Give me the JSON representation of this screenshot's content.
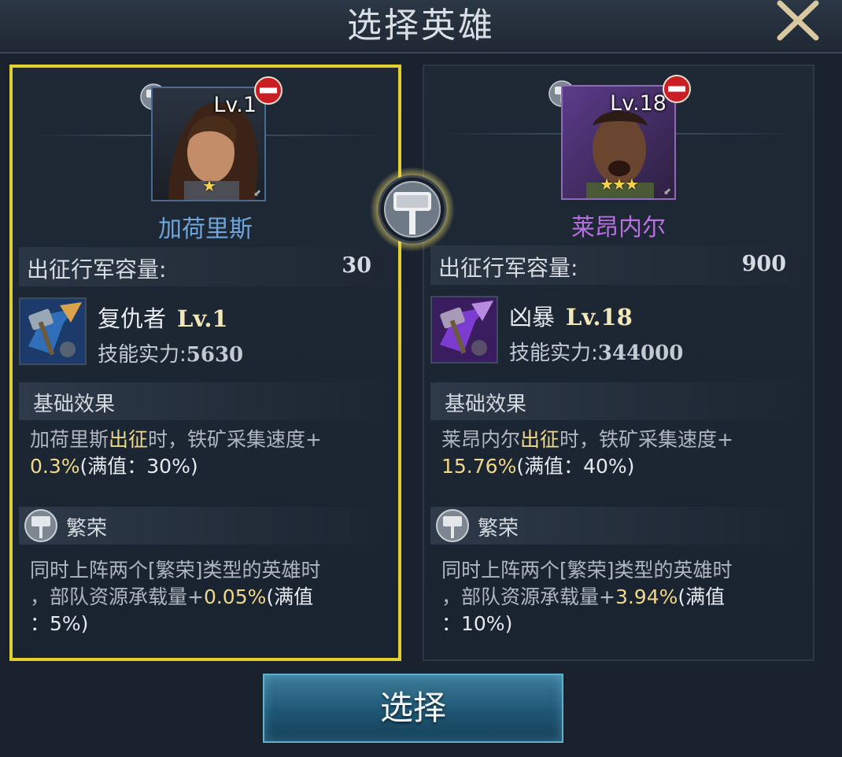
{
  "window": {
    "title": "选择英雄",
    "close_icon": "close-x-icon"
  },
  "heroes": [
    {
      "name": "加荷里斯",
      "name_color": "#6ea5dd",
      "level": "Lv.1",
      "stars": "★",
      "selected": true,
      "capacity_label": "出征行军容量:",
      "capacity_value": "30",
      "skill": {
        "name": "复仇者",
        "level": "Lv.1",
        "power_label": "技能实力:",
        "power_value": "5630",
        "icon": "hammer-blue-icon"
      },
      "base_effect": {
        "title": "基础效果",
        "line1_pre": "加荷里斯",
        "line1_hl": "出征",
        "line1_post": "时，铁矿采集速度+",
        "line2_val": "0.3%",
        "line2_rest": "(满值：30%)"
      },
      "trait": {
        "title": "繁荣",
        "line1": "同时上阵两个[繁荣]类型的英雄时",
        "line2_pre": "，部队资源承载量+",
        "line2_val": "0.05%",
        "line2_post": "(满值",
        "line3": "：5%)"
      }
    },
    {
      "name": "莱昂内尔",
      "name_color": "#b870e0",
      "level": "Lv.18",
      "stars": "★★★",
      "selected": false,
      "capacity_label": "出征行军容量:",
      "capacity_value": "900",
      "skill": {
        "name": "凶暴",
        "level": "Lv.18",
        "power_label": "技能实力:",
        "power_value": "344000",
        "icon": "hammer-purple-icon"
      },
      "base_effect": {
        "title": "基础效果",
        "line1_pre": "莱昂内尔",
        "line1_hl": "出征",
        "line1_post": "时，铁矿采集速度+",
        "line2_val": "15.76%",
        "line2_rest": "(满值：40%)"
      },
      "trait": {
        "title": "繁荣",
        "line1": "同时上阵两个[繁荣]类型的英雄时",
        "line2_pre": "，部队资源承载量+",
        "line2_val": "3.94%",
        "line2_post": "(满值",
        "line3": "：10%)"
      }
    }
  ],
  "select_button": {
    "label": "选择"
  },
  "colors": {
    "selected_border": "#e3cf2e",
    "accent_gold": "#f0d88a",
    "button": "#1f5673"
  }
}
